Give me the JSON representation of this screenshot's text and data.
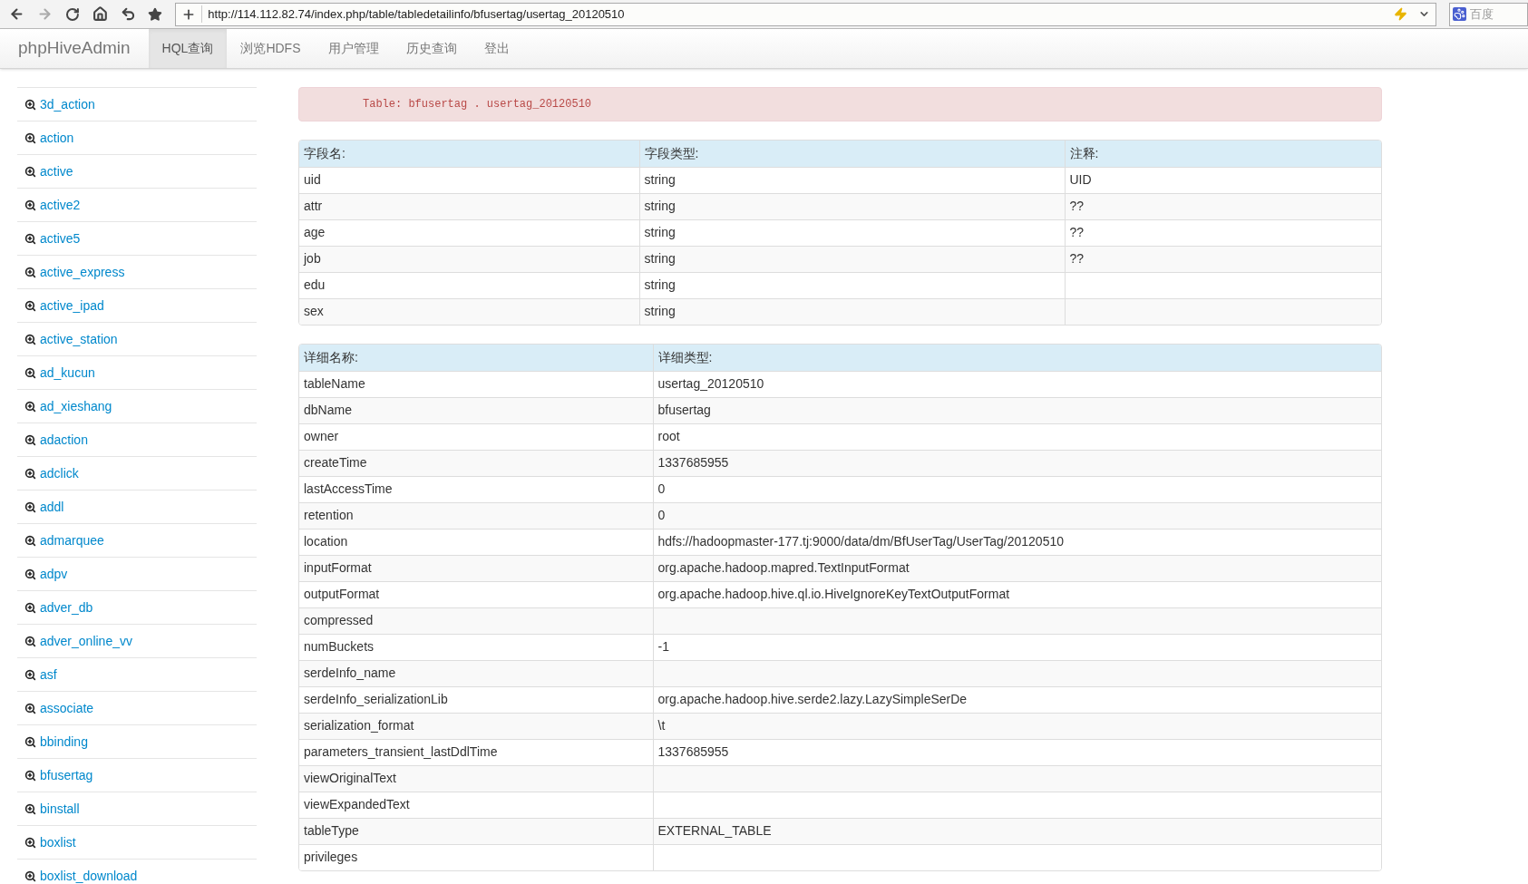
{
  "browser": {
    "url": "http://114.112.82.74/index.php/table/tabledetailinfo/bfusertag/usertag_20120510",
    "search_placeholder": "百度"
  },
  "navbar": {
    "brand": "phpHiveAdmin",
    "items": [
      {
        "label": "HQL查询",
        "selected": true
      },
      {
        "label": "浏览HDFS",
        "selected": false
      },
      {
        "label": "用户管理",
        "selected": false
      },
      {
        "label": "历史查询",
        "selected": false
      },
      {
        "label": "登出",
        "selected": false
      }
    ]
  },
  "sidebar": {
    "items": [
      "3d_action",
      "action",
      "active",
      "active2",
      "active5",
      "active_express",
      "active_ipad",
      "active_station",
      "ad_kucun",
      "ad_xieshang",
      "adaction",
      "adclick",
      "addl",
      "admarquee",
      "adpv",
      "adver_db",
      "adver_online_vv",
      "asf",
      "associate",
      "bbinding",
      "bfusertag",
      "binstall",
      "boxlist",
      "boxlist_download"
    ]
  },
  "alert": {
    "text": "Table: bfusertag . usertag_20120510"
  },
  "fields_table": {
    "columns": [
      "字段名:",
      "字段类型:",
      "注释:"
    ],
    "rows": [
      [
        "uid",
        "string",
        "UID"
      ],
      [
        "attr",
        "string",
        "??"
      ],
      [
        "age",
        "string",
        "??"
      ],
      [
        "job",
        "string",
        "??"
      ],
      [
        "edu",
        "string",
        ""
      ],
      [
        "sex",
        "string",
        ""
      ]
    ]
  },
  "details_table": {
    "columns": [
      "详细名称:",
      "详细类型:"
    ],
    "rows": [
      [
        "tableName",
        "usertag_20120510"
      ],
      [
        "dbName",
        "bfusertag"
      ],
      [
        "owner",
        "root"
      ],
      [
        "createTime",
        "1337685955"
      ],
      [
        "lastAccessTime",
        "0"
      ],
      [
        "retention",
        "0"
      ],
      [
        "location",
        "hdfs://hadoopmaster-177.tj:9000/data/dm/BfUserTag/UserTag/20120510"
      ],
      [
        "inputFormat",
        "org.apache.hadoop.mapred.TextInputFormat"
      ],
      [
        "outputFormat",
        "org.apache.hadoop.hive.ql.io.HiveIgnoreKeyTextOutputFormat"
      ],
      [
        "compressed",
        ""
      ],
      [
        "numBuckets",
        "-1"
      ],
      [
        "serdeInfo_name",
        ""
      ],
      [
        "serdeInfo_serializationLib",
        "org.apache.hadoop.hive.serde2.lazy.LazySimpleSerDe"
      ],
      [
        "serialization_format",
        "\\t"
      ],
      [
        "parameters_transient_lastDdlTime",
        "1337685955"
      ],
      [
        "viewOriginalText",
        ""
      ],
      [
        "viewExpandedText",
        ""
      ],
      [
        "tableType",
        "EXTERNAL_TABLE"
      ],
      [
        "privileges",
        ""
      ]
    ]
  }
}
